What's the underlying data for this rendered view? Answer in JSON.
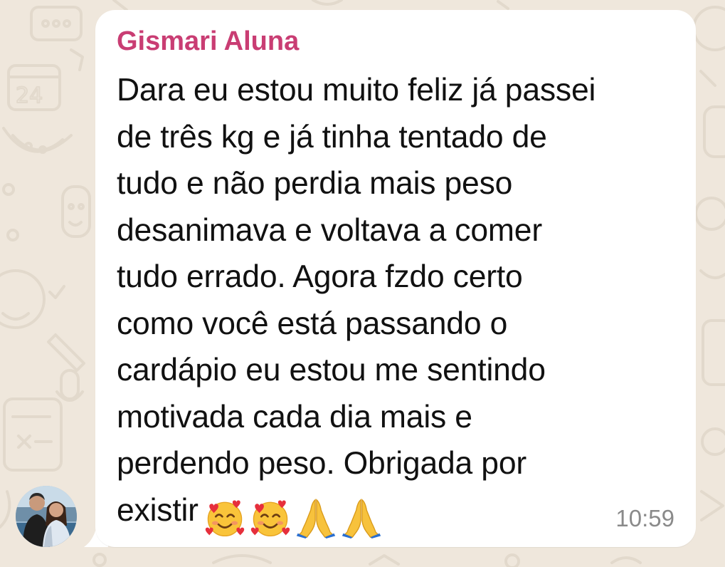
{
  "colors": {
    "wallpaper": "#efe7dc",
    "bubble": "#ffffff",
    "sender_name": "#c93d73",
    "message_text": "#111111",
    "timestamp": "#8a8a8a"
  },
  "chat": {
    "message": {
      "sender": "Gismari Aluna",
      "lines": [
        "Dara eu estou muito feliz já passei",
        "de três kg e já tinha tentado de",
        "tudo e não perdia mais peso",
        "desanimava e voltava a comer",
        "tudo errado. Agora fzdo certo",
        "como você está passando o",
        "cardápio eu estou me sentindo",
        "motivada cada dia mais e",
        "perdendo peso. Obrigada por",
        "existir"
      ],
      "emojis": [
        "smiling-face-with-hearts-icon",
        "smiling-face-with-hearts-icon",
        "folded-hands-icon",
        "folded-hands-icon"
      ],
      "time": "10:59"
    },
    "avatar": {
      "description_icon": "sender-avatar"
    }
  }
}
